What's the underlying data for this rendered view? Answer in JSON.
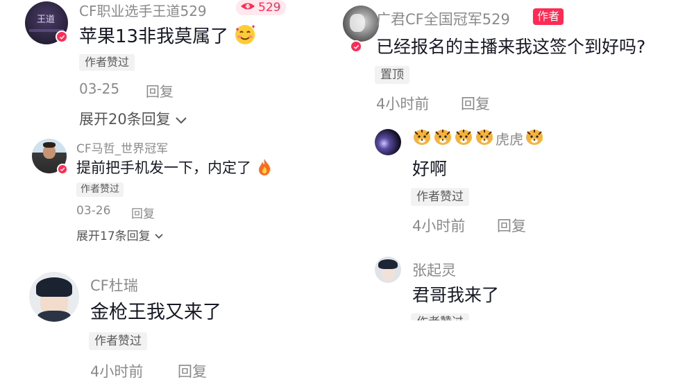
{
  "left": {
    "comment1": {
      "username": "CF职业选手王道529",
      "level_badge": "529",
      "avatar_text": "王道",
      "text": "苹果13非我莫属了",
      "emoji": "smiling-face-with-hearts",
      "liked_tag": "作者赞过",
      "date": "03-25",
      "reply": "回复",
      "expand": "展开20条回复"
    },
    "comment2": {
      "username": "CF马哲_世界冠军",
      "text": "提前把手机发一下，内定了",
      "emoji": "fire",
      "liked_tag": "作者赞过",
      "date": "03-26",
      "reply": "回复",
      "expand": "展开17条回复"
    },
    "comment3": {
      "username": "CF杜瑞",
      "text": "金枪王我又来了",
      "liked_tag": "作者赞过",
      "date": "4小时前",
      "reply": "回复"
    }
  },
  "right": {
    "comment1": {
      "username": "广君CF全国冠军529",
      "author_tag": "作者",
      "text": "已经报名的主播来我这签个到好吗?",
      "pinned_tag": "置顶",
      "date": "4小时前",
      "reply": "回复"
    },
    "reply1": {
      "username": "虎虎",
      "username_emoji": "tiger-face",
      "text": "好啊",
      "liked_tag": "作者赞过",
      "date": "4小时前",
      "reply": "回复"
    },
    "reply2": {
      "username": "张起灵",
      "text": "君哥我来了",
      "liked_tag_partial": "作者赞过"
    }
  },
  "colors": {
    "accent": "#fe2c55",
    "name_gray": "#8a8a8a",
    "text_dark": "#161823",
    "tag_bg": "#f2f2f2"
  }
}
